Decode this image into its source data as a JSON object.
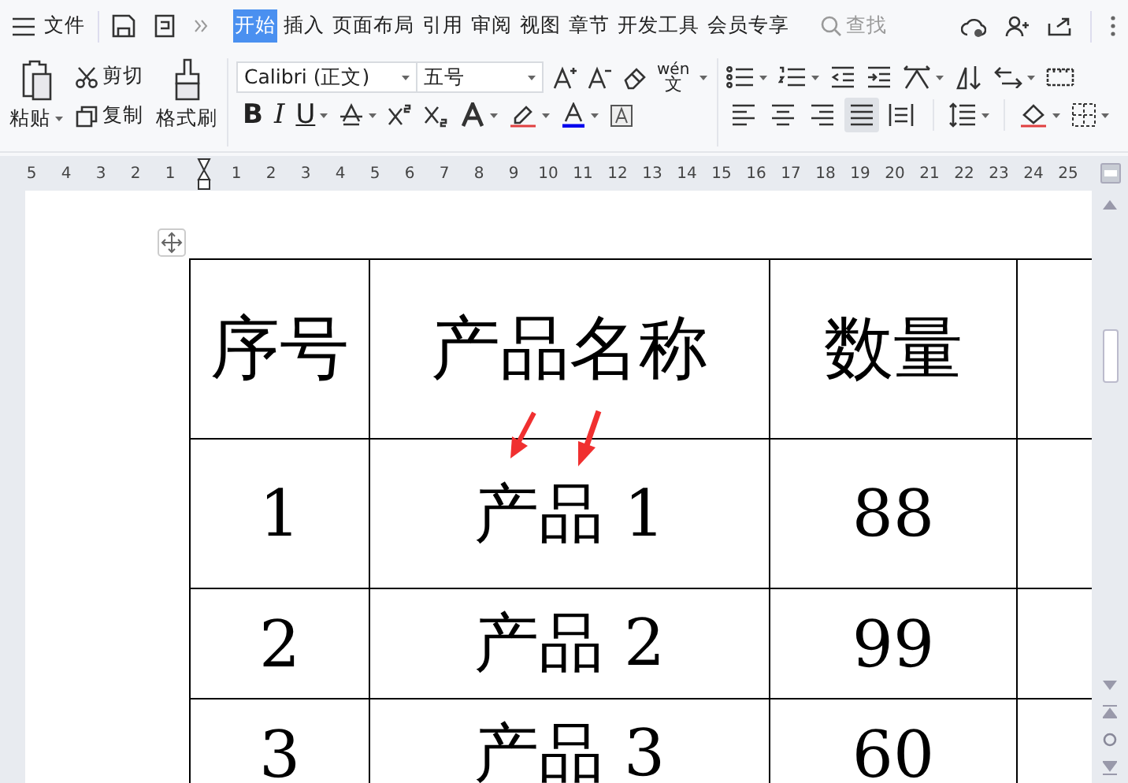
{
  "menu_bar": {
    "file_label": "文件",
    "tabs": [
      {
        "label": "开始",
        "selected": true
      },
      {
        "label": "插入",
        "selected": false
      },
      {
        "label": "页面布局",
        "selected": false
      },
      {
        "label": "引用",
        "selected": false
      },
      {
        "label": "审阅",
        "selected": false
      },
      {
        "label": "视图",
        "selected": false
      },
      {
        "label": "章节",
        "selected": false
      },
      {
        "label": "开发工具",
        "selected": false
      },
      {
        "label": "会员专享",
        "selected": false
      }
    ],
    "search": {
      "placeholder": "查找"
    }
  },
  "ribbon": {
    "clipboard": {
      "paste": "粘贴",
      "cut": "剪切",
      "copy": "复制",
      "format_painter": "格式刷"
    },
    "font": {
      "name": "Calibri (正文)",
      "size": "五号",
      "pinyin": "wén",
      "pinyin_char": "文",
      "bold": "B",
      "italic": "I",
      "underline": "U"
    },
    "alignments": [
      {
        "kind": "left",
        "selected": false
      },
      {
        "kind": "center",
        "selected": false
      },
      {
        "kind": "right",
        "selected": false
      },
      {
        "kind": "justify",
        "selected": true
      },
      {
        "kind": "distributed",
        "selected": false
      }
    ]
  },
  "ruler": {
    "left_numbers": [
      "5",
      "4",
      "3",
      "2",
      "1"
    ],
    "right_numbers": [
      "1",
      "2",
      "3",
      "4",
      "5",
      "6",
      "7",
      "8",
      "9",
      "10",
      "11",
      "12",
      "13",
      "14",
      "15",
      "16",
      "17",
      "18",
      "19",
      "20",
      "21",
      "22",
      "23",
      "24",
      "25"
    ]
  },
  "table": {
    "columns": [
      "序号",
      "产品名称",
      "数量"
    ],
    "rows": [
      [
        "1",
        "产品 1",
        "88"
      ],
      [
        "2",
        "产品 2",
        "99"
      ],
      [
        "3",
        "产品 3",
        "60"
      ]
    ]
  }
}
